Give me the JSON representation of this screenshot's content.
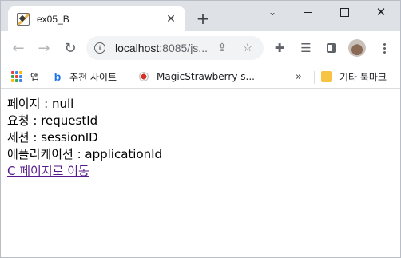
{
  "browser": {
    "tab_title": "ex05_B",
    "new_tab_symbol": "+",
    "address": {
      "host": "localhost",
      "rest": ":8085/js..."
    }
  },
  "bookmarks": [
    {
      "label": "앱",
      "icon": "apps-grid-icon"
    },
    {
      "label": "추천 사이트",
      "icon": "bing-icon"
    },
    {
      "label": "MagicStrawberry s...",
      "icon": "strawberry-icon"
    }
  ],
  "bookmarks_more": "»",
  "other_bookmarks": "기타 북마크",
  "page": {
    "lines": [
      "페이지 : null",
      "요청 : requestId",
      "세션 : sessionID",
      "애플리케이션 : applicationId"
    ],
    "link": "C 페이지로 이동"
  },
  "colors": {
    "tab_strip": "#dee1e6",
    "visited_link": "#551a8b"
  }
}
